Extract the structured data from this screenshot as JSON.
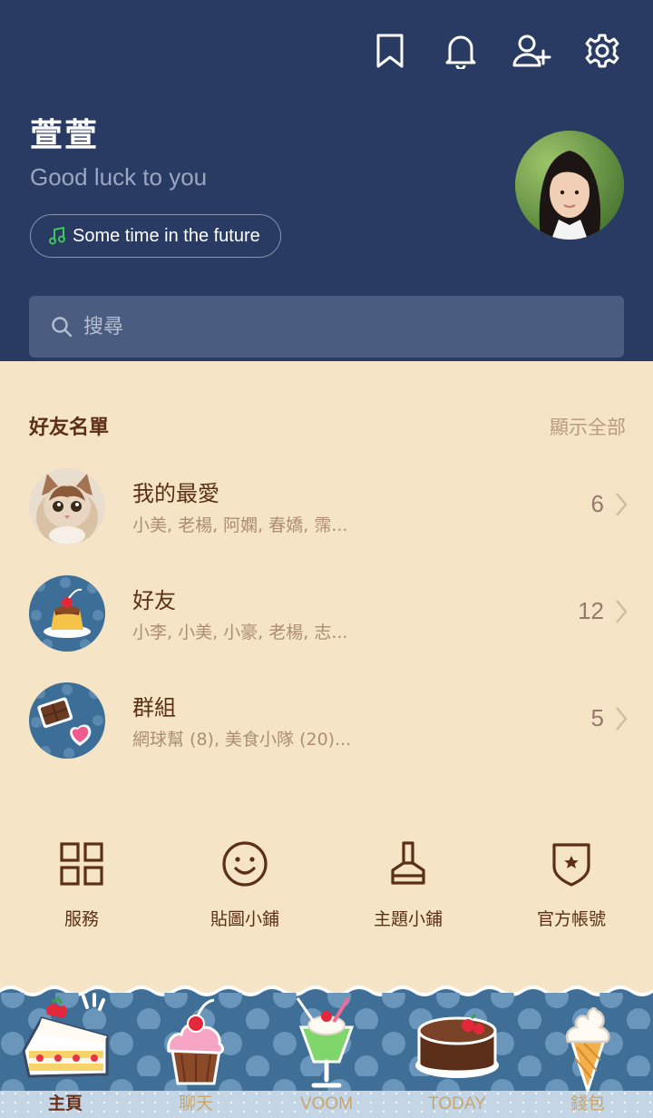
{
  "header": {
    "icons": [
      "bookmark-icon",
      "bell-icon",
      "add-friend-icon",
      "settings-icon"
    ],
    "user_name": "萱萱",
    "status_message": "Good luck to you",
    "music_text": "Some time in the future",
    "search_placeholder": "搜尋"
  },
  "friends": {
    "title": "好友名單",
    "show_all": "顯示全部",
    "rows": [
      {
        "name": "我的最愛",
        "members": "小美, 老楊, 阿嫻, 春嬌, 霈...",
        "count": "6"
      },
      {
        "name": "好友",
        "members": "小李, 小美, 小豪, 老楊, 志...",
        "count": "12"
      },
      {
        "name": "群組",
        "members": "網球幫 (8), 美食小隊 (20)...",
        "count": "5"
      }
    ]
  },
  "services": [
    {
      "label": "服務",
      "icon": "grid-icon"
    },
    {
      "label": "貼圖小鋪",
      "icon": "smiley-icon"
    },
    {
      "label": "主題小鋪",
      "icon": "brush-icon"
    },
    {
      "label": "官方帳號",
      "icon": "shield-star-icon"
    }
  ],
  "tabs": [
    {
      "label": "主頁",
      "icon": "cake-slice-icon",
      "active": true
    },
    {
      "label": "聊天",
      "icon": "cupcake-icon",
      "active": false
    },
    {
      "label": "VOOM",
      "icon": "cream-soda-icon",
      "active": false
    },
    {
      "label": "TODAY",
      "icon": "chocolate-cake-icon",
      "active": false
    },
    {
      "label": "錢包",
      "icon": "ice-cream-icon",
      "active": false
    }
  ],
  "colors": {
    "header_bg": "#293b62",
    "body_bg": "#f5e5c6",
    "text_brown": "#5c2f17",
    "tabbar_bg": "#3f6f97",
    "music_note": "#3ec65a"
  }
}
